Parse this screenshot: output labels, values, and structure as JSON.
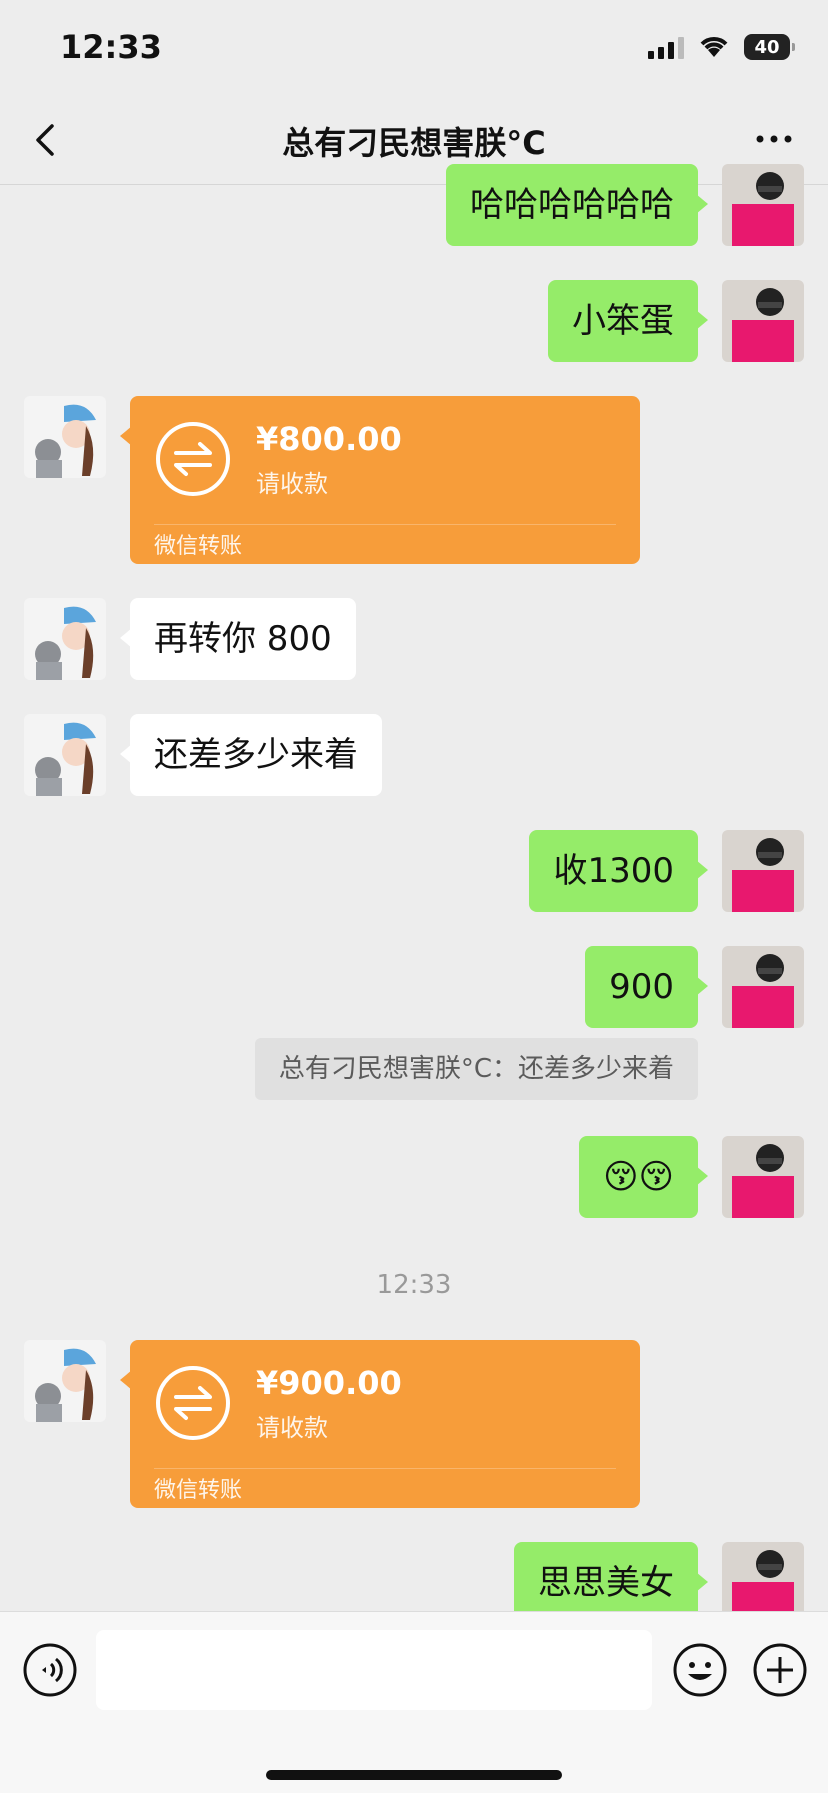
{
  "status": {
    "time": "12:33",
    "battery": "40"
  },
  "header": {
    "title": "总有刁民想害朕°C"
  },
  "messages": [
    {
      "side": "right",
      "text": "哈哈哈哈哈哈"
    },
    {
      "side": "right",
      "text": "小笨蛋"
    },
    {
      "side": "left",
      "type": "transfer",
      "amount": "¥800.00",
      "sub": "请收款",
      "footer": "微信转账"
    },
    {
      "side": "left",
      "text": "再转你 800"
    },
    {
      "side": "left",
      "text": "还差多少来着"
    },
    {
      "side": "right",
      "text": "收1300"
    },
    {
      "side": "right",
      "text": "900"
    },
    {
      "type": "quote",
      "text": "总有刁民想害朕°C：还差多少来着"
    },
    {
      "side": "right",
      "text": "😚😚"
    },
    {
      "type": "time",
      "text": "12:33"
    },
    {
      "side": "left",
      "type": "transfer",
      "amount": "¥900.00",
      "sub": "请收款",
      "footer": "微信转账"
    },
    {
      "side": "right",
      "text": "思思美女"
    }
  ],
  "input": {
    "placeholder": ""
  },
  "colors": {
    "green_bubble": "#95ec69",
    "transfer_orange": "#f79d3a",
    "background": "#ededed"
  },
  "icons": [
    "back-icon",
    "more-icon",
    "voice-icon",
    "emoji-icon",
    "plus-icon",
    "transfer-icon",
    "wifi-icon",
    "signal-icon",
    "battery-icon"
  ]
}
